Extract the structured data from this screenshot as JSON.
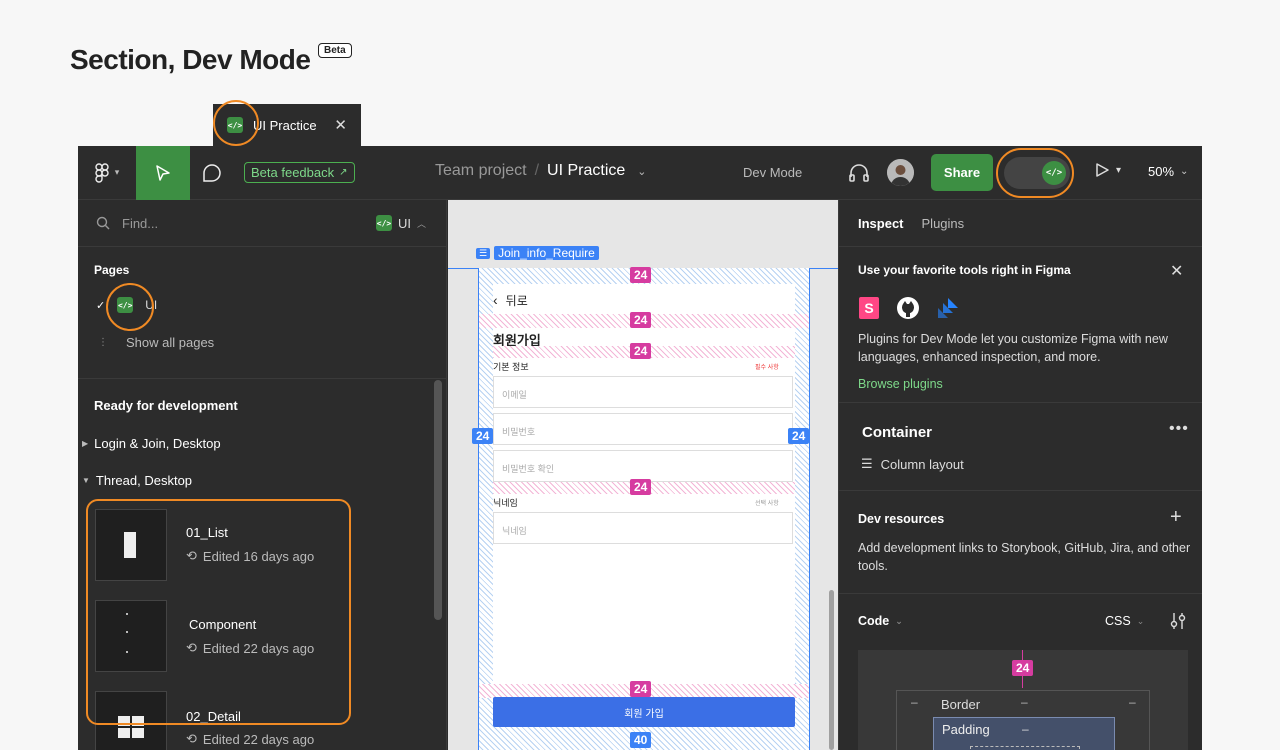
{
  "heading": "Section,  Dev Mode",
  "beta_pill": "Beta",
  "tab": {
    "label": "UI Practice",
    "close": "✕"
  },
  "toolbar": {
    "beta_feedback": "Beta feedback",
    "team": "Team project",
    "separator": "/",
    "file": "UI Practice",
    "dev_mode": "Dev Mode",
    "share": "Share",
    "zoom": "50%"
  },
  "left_panel": {
    "find_placeholder": "Find...",
    "page_selector": "UI",
    "pages_title": "Pages",
    "current_page": "UI",
    "show_all": "Show all pages",
    "ready_title": "Ready for development",
    "groups": [
      {
        "label": "Login & Join, Desktop",
        "expanded": false
      },
      {
        "label": "Thread, Desktop",
        "expanded": true
      }
    ],
    "items": [
      {
        "name": "01_List",
        "edited": "Edited 16 days ago"
      },
      {
        "name": "Component",
        "edited": "Edited 22 days ago"
      },
      {
        "name": "02_Detail",
        "edited": "Edited 22 days ago"
      }
    ]
  },
  "canvas": {
    "frame_label": "Join_info_Require",
    "back": "뒤로",
    "title": "회원가입",
    "section_basic": "기본 정보",
    "required_note": "필수 사항",
    "fields": [
      "이메일",
      "비밀번호",
      "비밀번호 확인"
    ],
    "section_nick": "닉네임",
    "optional_note": "선택 사항",
    "nick_field": "닉네임",
    "join_button": "회원 가입",
    "spacing": {
      "top": "24",
      "a": "24",
      "b": "24",
      "left": "24",
      "right": "24",
      "c": "24",
      "d": "24",
      "bottom": "40"
    }
  },
  "right_panel": {
    "tabs": [
      "Inspect",
      "Plugins"
    ],
    "promo_title": "Use your favorite tools right in Figma",
    "promo_text": "Plugins for Dev Mode let you customize Figma with new languages, enhanced inspection, and more.",
    "browse": "Browse plugins",
    "container_title": "Container",
    "column_layout": "Column layout",
    "devres_title": "Dev resources",
    "devres_text": "Add development links to Storybook, GitHub, Jira, and other tools.",
    "code_title": "Code",
    "code_lang": "CSS",
    "box_model": {
      "margin_top": "24",
      "border": "Border",
      "padding": "Padding",
      "dash": "–"
    }
  },
  "colors": {
    "accent_green": "#3d8f43",
    "highlight_orange": "#f08a24",
    "spacing_pink": "#d63ca0",
    "frame_blue": "#3b82f6"
  }
}
